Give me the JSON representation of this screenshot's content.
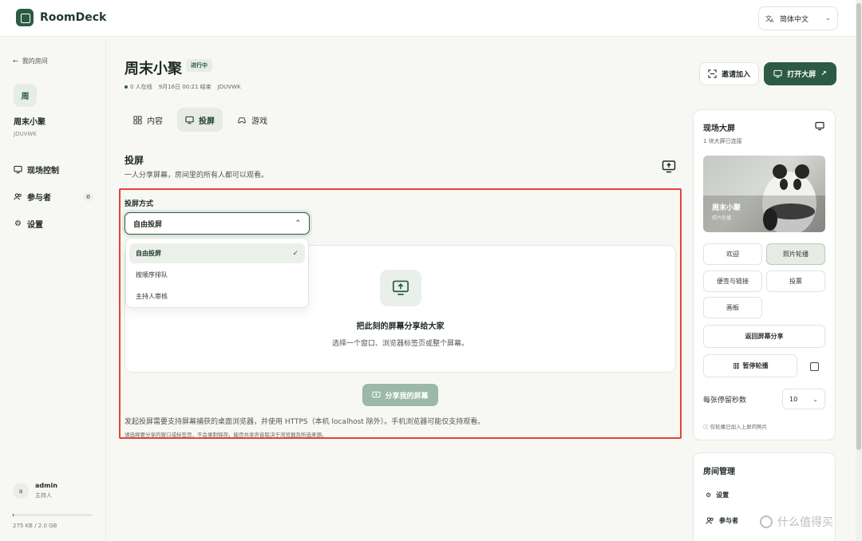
{
  "app": {
    "name": "RoomDeck",
    "language": "简体中文"
  },
  "sidebar": {
    "back_label": "我的房间",
    "room_avatar": "周",
    "room_name": "周末小聚",
    "room_code": "JDUVWK",
    "items": [
      {
        "label": "现场控制",
        "icon": "monitor-icon"
      },
      {
        "label": "参与者",
        "icon": "users-icon",
        "count": "0"
      },
      {
        "label": "设置",
        "icon": "gear-icon"
      }
    ],
    "user": {
      "avatar": "a",
      "name": "admin",
      "role": "主持人"
    },
    "storage": {
      "text": "275 KB / 2.0 GB",
      "fraction": 0.0001
    }
  },
  "header": {
    "title": "周末小聚",
    "status": "进行中",
    "meta": {
      "online": "0 人在线",
      "ends": "9月16日 00:21 结束",
      "code": "JDUVWK"
    },
    "invite_label": "邀请加入",
    "open_screen_label": "打开大屏"
  },
  "tabs": [
    {
      "label": "内容",
      "icon": "grid-icon",
      "active": false
    },
    {
      "label": "投屏",
      "icon": "monitor-icon",
      "active": true
    },
    {
      "label": "游戏",
      "icon": "gamepad-icon",
      "active": false
    }
  ],
  "cast": {
    "title": "投屏",
    "subtitle": "一人分享屏幕，房间里的所有人都可以观看。",
    "mode_label": "投屏方式",
    "mode_value": "自由投屏",
    "options": [
      {
        "label": "自由投屏",
        "selected": true
      },
      {
        "label": "按顺序排队",
        "selected": false
      },
      {
        "label": "主持人审核",
        "selected": false
      }
    ],
    "share_heading": "把此刻的屏幕分享给大家",
    "share_desc": "选择一个窗口、浏览器标签页或整个屏幕。",
    "share_button": "分享我的屏幕",
    "note1": "发起投屏需要支持屏幕捕获的桌面浏览器，并使用 HTTPS（本机 localhost 除外）。手机浏览器可能仅支持观看。",
    "note2": "请选择要分享的窗口或标签页，不会录制保存。能否共享声音取决于浏览器及所选来源。"
  },
  "screen_panel": {
    "title": "现场大屏",
    "subtitle": "1 块大屏已连接",
    "preview_title": "周末小聚",
    "preview_sub": "照片轮播",
    "buttons": [
      {
        "label": "欢迎",
        "active": false
      },
      {
        "label": "照片轮播",
        "active": true
      },
      {
        "label": "便签与链接",
        "active": false
      },
      {
        "label": "投票",
        "active": false
      },
      {
        "label": "画板",
        "active": false
      }
    ],
    "return_label": "返回屏幕分享",
    "pause_label": "暂停轮播",
    "dwell_label": "每张停留秒数",
    "dwell_value": "10",
    "note": "仅轮播已加入上屏的照片"
  },
  "room_panel": {
    "title": "房间管理",
    "items": [
      {
        "label": "设置"
      },
      {
        "label": "参与者"
      }
    ]
  },
  "watermark": "什么值得买",
  "colors": {
    "accent": "#2d5a43",
    "highlight": "#e4433c"
  }
}
